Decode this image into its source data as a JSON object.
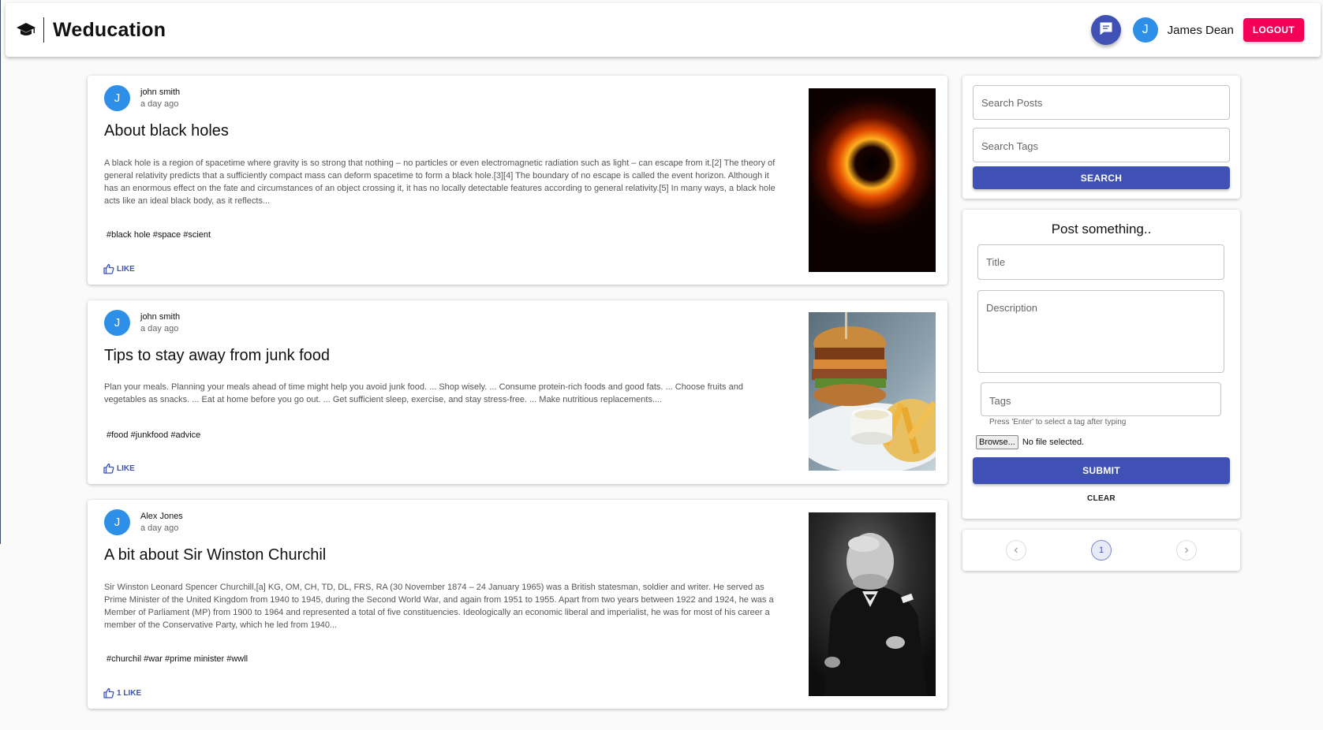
{
  "header": {
    "brand": "Weducation",
    "user_name": "James Dean",
    "user_initial": "J",
    "logout_label": "LOGOUT"
  },
  "posts": [
    {
      "author": "john smith",
      "initial": "J",
      "time": "a day ago",
      "title": "About black holes",
      "description": "A black hole is a region of spacetime where gravity is so strong that nothing – no particles or even electromagnetic radiation such as light – can escape from it.[2] The theory of general relativity predicts that a sufficiently compact mass can deform spacetime to form a black hole.[3][4] The boundary of no escape is called the event horizon. Although it has an enormous effect on the fate and circumstances of an object crossing it, it has no locally detectable features according to general relativity.[5] In many ways, a black hole acts like an ideal black body, as it reflects...",
      "tags": "#black hole #space #scient",
      "like_label": "LIKE"
    },
    {
      "author": "john smith",
      "initial": "J",
      "time": "a day ago",
      "title": "Tips to stay away from junk food",
      "description": "Plan your meals. Planning your meals ahead of time might help you avoid junk food. ... Shop wisely. ... Consume protein-rich foods and good fats. ... Choose fruits and vegetables as snacks. ... Eat at home before you go out. ... Get sufficient sleep, exercise, and stay stress-free. ... Make nutritious replacements....",
      "tags": "#food #junkfood #advice",
      "like_label": "LIKE"
    },
    {
      "author": "Alex Jones",
      "initial": "J",
      "time": "a day ago",
      "title": "A bit about Sir Winston Churchil",
      "description": "Sir Winston Leonard Spencer Churchill,[a] KG, OM, CH, TD, DL, FRS, RA (30 November 1874 – 24 January 1965) was a British statesman, soldier and writer. He served as Prime Minister of the United Kingdom from 1940 to 1945, during the Second World War, and again from 1951 to 1955. Apart from two years between 1922 and 1924, he was a Member of Parliament (MP) from 1900 to 1964 and represented a total of five constituencies. Ideologically an economic liberal and imperialist, he was for most of his career a member of the Conservative Party, which he led from 1940...",
      "tags": "#churchil #war #prime minister #wwll",
      "like_label": "1 LIKE"
    }
  ],
  "search": {
    "posts_placeholder": "Search Posts",
    "tags_placeholder": "Search Tags",
    "button_label": "SEARCH"
  },
  "compose": {
    "heading": "Post something..",
    "title_placeholder": "Title",
    "description_placeholder": "Description",
    "tags_placeholder": "Tags",
    "tags_hint": "Press 'Enter' to select a tag after typing",
    "browse_label": "Browse...",
    "no_file": "No file selected.",
    "submit_label": "SUBMIT",
    "clear_label": "CLEAR"
  },
  "pagination": {
    "current_page": "1",
    "prev_icon": "chevron-left-icon",
    "next_icon": "chevron-right-icon"
  },
  "colors": {
    "primary": "#3f51b5",
    "logout": "#f50057",
    "avatar": "#2d8fe8"
  }
}
